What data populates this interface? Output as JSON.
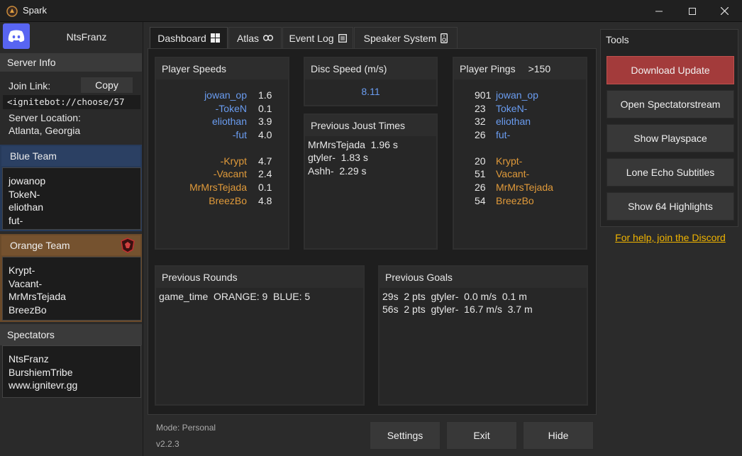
{
  "window": {
    "title": "Spark"
  },
  "sidebar": {
    "username": "NtsFranz",
    "server_info_title": "Server Info",
    "join_link_label": "Join Link:",
    "copy_label": "Copy",
    "join_link_value": "<ignitebot://choose/57",
    "server_location_label": "Server Location:",
    "server_location_value": "Atlanta, Georgia",
    "blue_team_title": "Blue Team",
    "blue_team": [
      "jowanop",
      "TokeN-",
      "eliothan",
      "fut-"
    ],
    "orange_team_title": "Orange Team",
    "orange_team": [
      "Krypt-",
      "Vacant-",
      "MrMrsTejada",
      "BreezBo"
    ],
    "spectators_title": "Spectators",
    "spectators": [
      "NtsFranz",
      "BurshiemTribe",
      "www.ignitevr.gg"
    ]
  },
  "tabs": [
    {
      "label": "Dashboard",
      "icon": "grid-icon"
    },
    {
      "label": "Atlas",
      "icon": "link-icon"
    },
    {
      "label": "Event Log",
      "icon": "document-icon"
    },
    {
      "label": "Speaker System",
      "icon": "speaker-icon"
    }
  ],
  "dashboard": {
    "player_speeds": {
      "title": "Player Speeds",
      "blue": [
        {
          "name": "jowan_op",
          "value": "1.6"
        },
        {
          "name": "-TokeN",
          "value": "0.1"
        },
        {
          "name": "eliothan",
          "value": "3.9"
        },
        {
          "name": "-fut",
          "value": "4.0"
        }
      ],
      "orange": [
        {
          "name": "-Krypt",
          "value": "4.7"
        },
        {
          "name": "-Vacant",
          "value": "2.4"
        },
        {
          "name": "MrMrsTejada",
          "value": "0.1"
        },
        {
          "name": "BreezBo",
          "value": "4.8"
        }
      ]
    },
    "disc_speed": {
      "title": "Disc Speed (m/s)",
      "value": "8.11"
    },
    "joust_times": {
      "title": "Previous Joust Times",
      "rows": [
        "MrMrsTejada  1.96 s",
        "gtyler-  1.83 s",
        "Ashh-  2.29 s"
      ]
    },
    "player_pings": {
      "title": "Player Pings",
      "threshold": ">150",
      "blue": [
        {
          "ping": "901",
          "name": "jowan_op"
        },
        {
          "ping": "23",
          "name": "TokeN-"
        },
        {
          "ping": "32",
          "name": "eliothan"
        },
        {
          "ping": "26",
          "name": "fut-"
        }
      ],
      "orange": [
        {
          "ping": "20",
          "name": "Krypt-"
        },
        {
          "ping": "51",
          "name": "Vacant-"
        },
        {
          "ping": "26",
          "name": "MrMrsTejada"
        },
        {
          "ping": "54",
          "name": "BreezBo"
        }
      ]
    },
    "previous_rounds": {
      "title": "Previous Rounds",
      "rows": [
        "game_time  ORANGE: 9  BLUE: 5"
      ]
    },
    "previous_goals": {
      "title": "Previous Goals",
      "rows": [
        "29s  2 pts  gtyler-  0.0 m/s  0.1 m",
        "56s  2 pts  gtyler-  16.7 m/s  3.7 m"
      ]
    }
  },
  "footer": {
    "mode": "Mode: Personal",
    "version": "v2.2.3",
    "settings_label": "Settings",
    "exit_label": "Exit",
    "hide_label": "Hide"
  },
  "tools": {
    "title": "Tools",
    "download_update": "Download Update",
    "open_spectatorstream": "Open Spectatorstream",
    "show_playspace": "Show Playspace",
    "lone_echo_subtitles": "Lone Echo Subtitles",
    "show_64_highlights": "Show 64 Highlights",
    "help_link": "For help, join the Discord"
  },
  "colors": {
    "blue_team": "#6a9cf0",
    "orange_team": "#e09a3a",
    "discord": "#5865f2",
    "primary_button": "#a33b3b",
    "link": "#f0b400"
  }
}
